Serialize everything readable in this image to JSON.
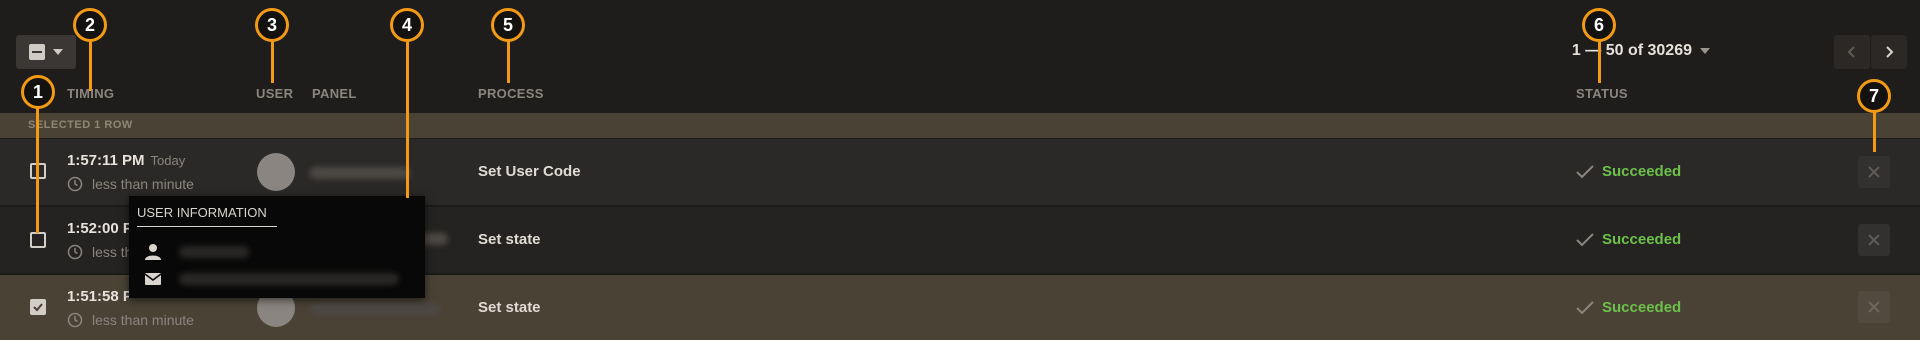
{
  "toolbar": {
    "bulk_select_icon": "minus-square-icon",
    "pagination": "1 — 50 of 30269",
    "prev_icon": "chevron-left-icon",
    "next_icon": "chevron-right-icon"
  },
  "columns": {
    "timing": "TIMING",
    "user": "USER",
    "panel": "PANEL",
    "process": "PROCESS",
    "status": "STATUS"
  },
  "selection_banner": "SELECTED 1 ROW",
  "rows": [
    {
      "time": "1:57:11 PM",
      "day": "Today",
      "duration": "less than minute",
      "process": "Set User Code",
      "status": "Succeeded",
      "checked": false
    },
    {
      "time": "1:52:00 P",
      "day": "",
      "duration": "less th",
      "process": "Set state",
      "status": "Succeeded",
      "checked": false
    },
    {
      "time": "1:51:58 P",
      "day": "",
      "duration": "less than minute",
      "process": "Set state",
      "status": "Succeeded",
      "checked": true
    }
  ],
  "popover": {
    "title": "USER INFORMATION",
    "person_icon": "person-icon",
    "email_icon": "envelope-icon"
  },
  "callouts": [
    "1",
    "2",
    "3",
    "4",
    "5",
    "6",
    "7"
  ],
  "colors": {
    "accent": "#f29a14",
    "success": "#6cc14a",
    "selected_row": "#4a4235",
    "background": "#1f1d1b"
  }
}
